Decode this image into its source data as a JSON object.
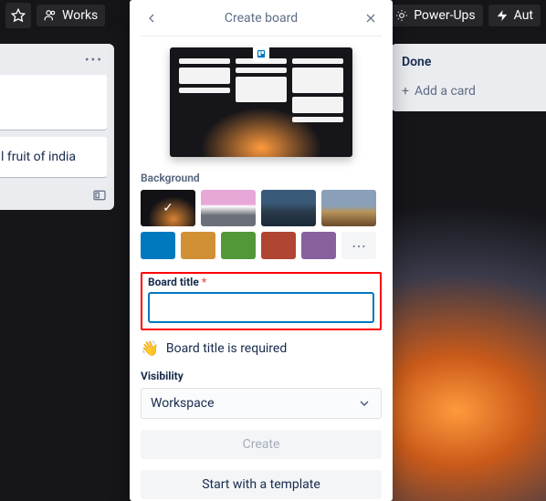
{
  "toolbar": {
    "workspace": "Works",
    "powerups": "Power-Ups",
    "automation": "Aut"
  },
  "left_list": {
    "card2": "l fruit of india"
  },
  "right_list": {
    "title": "Done",
    "add_card": "Add a card"
  },
  "modal": {
    "title": "Create board",
    "background_label": "Background",
    "colors": [
      "#0079bf",
      "#d29034",
      "#519839",
      "#b04632",
      "#89609e"
    ],
    "board_title_label": "Board title",
    "board_title_value": "",
    "required_hint": "Board title is required",
    "visibility_label": "Visibility",
    "visibility_value": "Workspace",
    "create_btn": "Create",
    "template_btn": "Start with a template"
  }
}
